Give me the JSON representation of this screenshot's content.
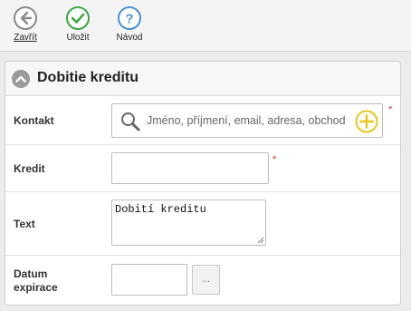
{
  "toolbar": {
    "close_label": "Zavřít",
    "save_label": "Uložit",
    "help_label": "Návod"
  },
  "panel": {
    "title": "Dobitie kreditu"
  },
  "form": {
    "contact": {
      "label": "Kontakt",
      "placeholder": "Jméno, příjmení, email, adresa, obchod",
      "required_mark": "*"
    },
    "credit": {
      "label": "Kredit",
      "value": "",
      "required_mark": "*"
    },
    "text": {
      "label": "Text",
      "value": "Dobití kreditu"
    },
    "expiry": {
      "label": "Datum expirace",
      "value": "",
      "picker_label": "..."
    }
  },
  "colors": {
    "close_icon": "#8a8a8a",
    "save_icon": "#3aa845",
    "help_icon": "#4a90d9",
    "add_icon": "#e8c81c",
    "required": "#d9302c"
  }
}
